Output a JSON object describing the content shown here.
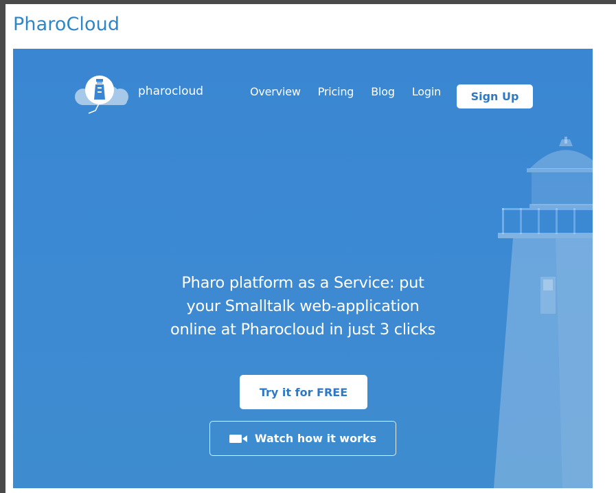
{
  "page": {
    "title": "PharoCloud"
  },
  "brand": {
    "name": "pharocloud",
    "logo_icon": "lighthouse-cloud-logo"
  },
  "nav": {
    "items": [
      {
        "label": "Overview"
      },
      {
        "label": "Pricing"
      },
      {
        "label": "Blog"
      },
      {
        "label": "Login"
      }
    ],
    "signup_label": "Sign Up"
  },
  "hero": {
    "headline_lines": [
      "Pharo platform as a Service: put",
      "your Smalltalk web-application",
      "online at Pharocloud in just 3 clicks"
    ],
    "primary_cta": "Try it for FREE",
    "secondary_cta": "Watch how it works",
    "secondary_cta_icon": "video-camera-icon",
    "background_image": "lighthouse-illustration"
  },
  "colors": {
    "title_blue": "#2f86c6",
    "hero_blue": "#3a86d2",
    "button_text_blue": "#2f78c4",
    "frame_gray": "#4a4a4a"
  }
}
